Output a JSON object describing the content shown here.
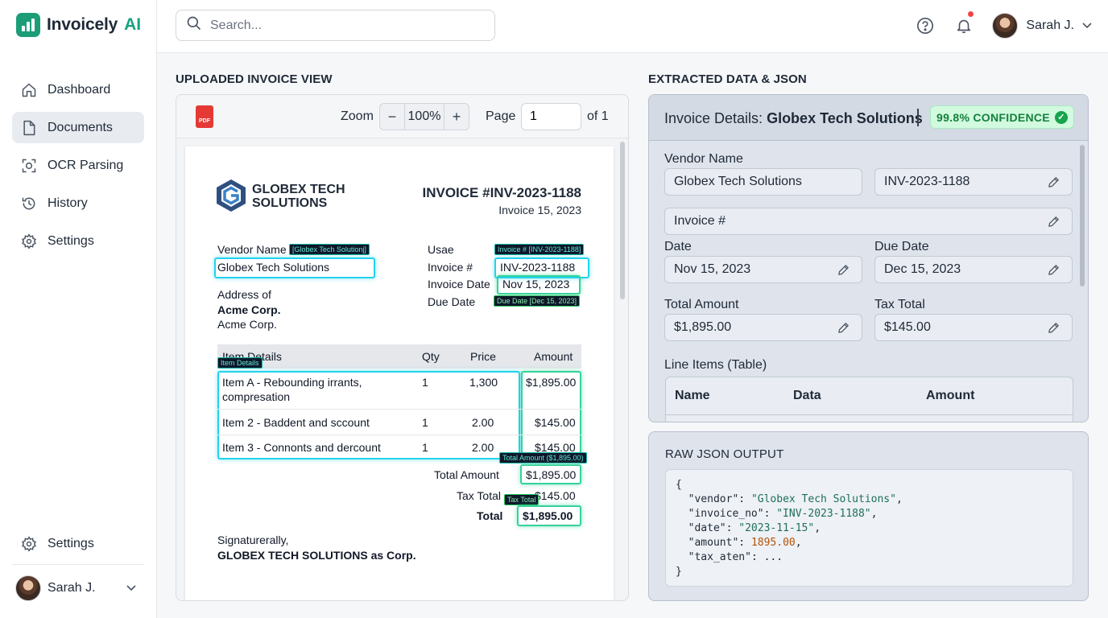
{
  "app": {
    "name": "Invoicely",
    "name_ai": "AI",
    "brand_color": "#1b9e77"
  },
  "sidebar": {
    "items": [
      {
        "label": "Dashboard",
        "icon": "home-icon"
      },
      {
        "label": "Documents",
        "icon": "document-icon",
        "active": true
      },
      {
        "label": "OCR Parsing",
        "icon": "scan-icon"
      },
      {
        "label": "History",
        "icon": "history-icon"
      },
      {
        "label": "Settings",
        "icon": "gear-icon"
      }
    ],
    "bottom_settings": "Settings",
    "user": "Sarah J."
  },
  "topbar": {
    "search_placeholder": "Search...",
    "user": "Sarah J."
  },
  "viewer": {
    "section_title": "UPLOADED INVOICE VIEW",
    "zoom_label": "Zoom",
    "zoom_value": "100%",
    "page_label": "Page",
    "page_value": "1",
    "page_of": "of 1",
    "pdf_label": "PDF"
  },
  "invoice": {
    "company_line1": "GLOBEX TECH",
    "company_line2": "SOLUTIONS",
    "title": "INVOICE #INV-2023-1188",
    "date": "Invoice 15, 2023",
    "vendor_label": "Vendor Name",
    "vendor_value": "Globex Tech Solutions",
    "address_label": "Address of",
    "address_line1": "Acme Corp.",
    "address_line2": "Acme Corp.",
    "meta_usae": "Usae",
    "meta_invoice_label": "Invoice #",
    "meta_invoice_value": "INV-2023-1188",
    "meta_date_label": "Invoice Date",
    "meta_date_value": "Nov 15, 2023",
    "meta_due_label": "Due Date",
    "table_headers": {
      "item": "Item Details",
      "qty": "Qty",
      "price": "Price",
      "amount": "Amount"
    },
    "rows": [
      {
        "item_line1": "Item A - Rebounding irrants,",
        "item_line2": "compresation",
        "qty": "1",
        "price": "1,300",
        "amount": "$1,895.00"
      },
      {
        "item_line1": "Item 2 - Baddent and sccount",
        "qty": "1",
        "price": "2.00",
        "amount": "$145.00"
      },
      {
        "item_line1": "Item 3 - Connonts and dercount",
        "qty": "1",
        "price": "2.00",
        "amount": "$145.00"
      }
    ],
    "total_amount_label": "Total Amount",
    "total_amount_value": "$1,895.00",
    "tax_total_label": "Tax Total",
    "tax_total_value": "$145.00",
    "total_label": "Total",
    "total_value": "$1,895.00",
    "sign_line1": "Signaturerally,",
    "sign_line2_a": "GLOBEX TECH SOLUTIONS as ",
    "sign_line2_b": "Corp.",
    "tags": {
      "vendor": "[Globex Tech Solutionj]",
      "invoice": "Invoice # [INV-2023-1188]",
      "due": "Due Date [Dec 15, 2023]",
      "items": "Item Details",
      "total_amount": "Total Amount ($1,895.00)",
      "tax": "Tax Total"
    }
  },
  "extracted": {
    "section_title": "EXTRACTED DATA & JSON",
    "title_prefix": "Invoice Details: ",
    "title_vendor": "Globex Tech Solutions",
    "confidence": "99.8% CONFIDENCE",
    "vendor_label": "Vendor Name",
    "vendor_value": "Globex Tech Solutions",
    "invoice_no_value": "INV-2023-1188",
    "invoice_no_field": "Invoice #",
    "date_label": "Date",
    "date_value": "Nov 15, 2023",
    "due_label": "Due Date",
    "due_value": "Dec 15, 2023",
    "total_label": "Total Amount",
    "total_value": "$1,895.00",
    "tax_label": "Tax Total",
    "tax_value": "$145.00",
    "line_items_label": "Line Items (Table)",
    "line_headers": {
      "name": "Name",
      "data": "Data",
      "amount": "Amount"
    }
  },
  "raw_json": {
    "title": "RAW JSON OUTPUT",
    "open": "{",
    "close": "}",
    "lines": [
      {
        "key": "\"vendor\"",
        "value": "\"Globex Tech Solutions\"",
        "type": "string",
        "end": ","
      },
      {
        "key": "\"invoice_no\"",
        "value": "\"INV-2023-1188\"",
        "type": "string",
        "end": ","
      },
      {
        "key": "\"date\"",
        "value": "\"2023-11-15\"",
        "type": "string",
        "end": ","
      },
      {
        "key": "\"amount\"",
        "value": "1895.00",
        "type": "number",
        "end": ","
      },
      {
        "key": "\"tax_aten\"",
        "value": "...",
        "type": "plain",
        "end": ""
      }
    ]
  }
}
